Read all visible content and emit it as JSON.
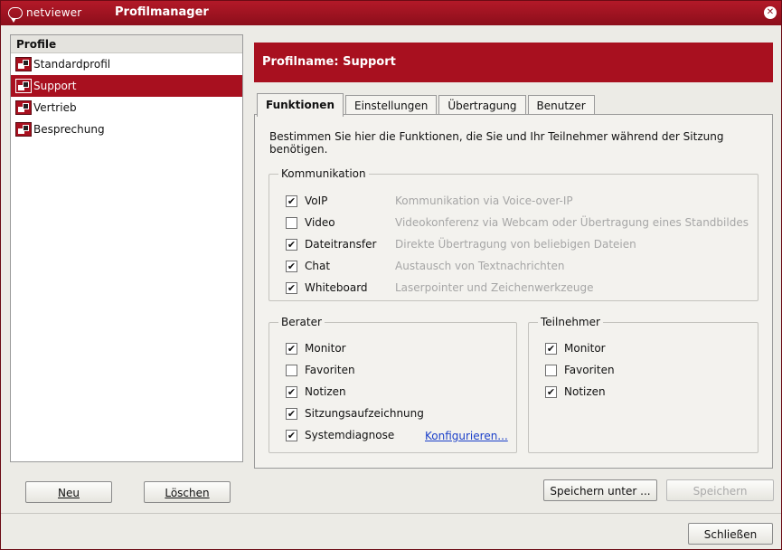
{
  "titlebar": {
    "logo_text": "netviewer",
    "title": "Profilmanager"
  },
  "sidebar": {
    "header": "Profile",
    "items": [
      {
        "label": "Standardprofil",
        "selected": false
      },
      {
        "label": "Support",
        "selected": true
      },
      {
        "label": "Vertrieb",
        "selected": false
      },
      {
        "label": "Besprechung",
        "selected": false
      }
    ],
    "new_button": "Neu",
    "delete_button": "Löschen"
  },
  "main": {
    "profile_name": "Profilname: Support",
    "tabs": [
      {
        "label": "Funktionen",
        "active": true
      },
      {
        "label": "Einstellungen",
        "active": false
      },
      {
        "label": "Übertragung",
        "active": false
      },
      {
        "label": "Benutzer",
        "active": false
      }
    ],
    "intro": "Bestimmen Sie hier die Funktionen, die Sie und Ihr Teilnehmer während der Sitzung benötigen.",
    "kommunikation": {
      "title": "Kommunikation",
      "items": [
        {
          "label": "VoIP",
          "checked": true,
          "description": "Kommunikation via Voice-over-IP"
        },
        {
          "label": "Video",
          "checked": false,
          "description": "Videokonferenz via Webcam oder Übertragung eines Standbildes"
        },
        {
          "label": "Dateitransfer",
          "checked": true,
          "description": "Direkte Übertragung von beliebigen Dateien"
        },
        {
          "label": "Chat",
          "checked": true,
          "description": "Austausch von Textnachrichten"
        },
        {
          "label": "Whiteboard",
          "checked": true,
          "description": "Laserpointer und Zeichenwerkzeuge"
        }
      ]
    },
    "berater": {
      "title": "Berater",
      "items": [
        {
          "label": "Monitor",
          "checked": true
        },
        {
          "label": "Favoriten",
          "checked": false
        },
        {
          "label": "Notizen",
          "checked": true
        },
        {
          "label": "Sitzungsaufzeichnung",
          "checked": true
        },
        {
          "label": "Systemdiagnose",
          "checked": true
        }
      ],
      "configure_link": "Konfigurieren..."
    },
    "teilnehmer": {
      "title": "Teilnehmer",
      "items": [
        {
          "label": "Monitor",
          "checked": true
        },
        {
          "label": "Favoriten",
          "checked": false
        },
        {
          "label": "Notizen",
          "checked": true
        }
      ]
    },
    "save_as_button": "Speichern unter ...",
    "save_button": "Speichern"
  },
  "footer": {
    "close_button": "Schließen"
  },
  "colors": {
    "brand_red": "#a8101f",
    "link": "#1a3fc9"
  }
}
